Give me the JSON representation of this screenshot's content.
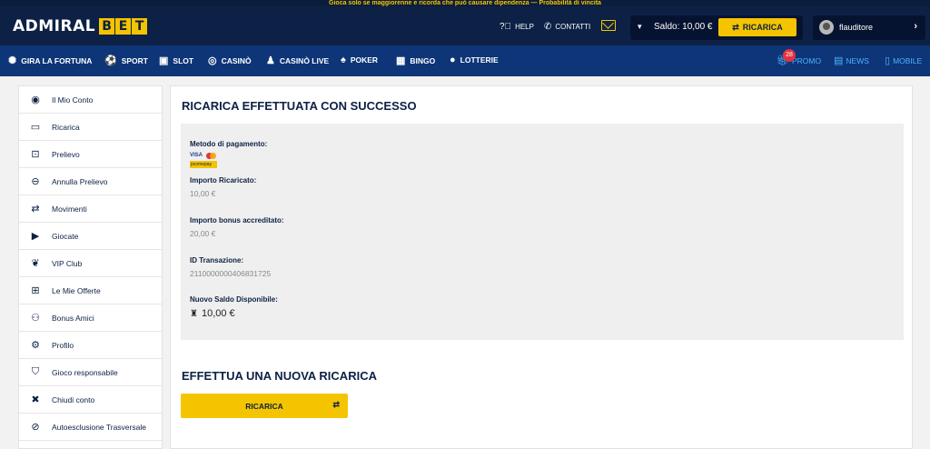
{
  "topbar": {
    "notice": "Gioca solo se maggiorenne e ricorda che può causare dipendenza — Probabilità di vincita"
  },
  "header": {
    "logo_left": "ADMIRAL",
    "logo_right": [
      "B",
      "E",
      "T"
    ],
    "help_label": "HELP",
    "contacts_label": "CONTATTI",
    "saldo_text": "Saldo: 10,00 €",
    "ricarica_label": "RICARICA",
    "username": "flauditore"
  },
  "nav": {
    "items": [
      {
        "label": "GIRA LA FORTUNA",
        "icon": "wheel-icon"
      },
      {
        "label": "SPORT",
        "icon": "soccer-ball-icon"
      },
      {
        "label": "SLOT",
        "icon": "slot-machine-icon"
      },
      {
        "label": "CASINÒ",
        "icon": "roulette-icon"
      },
      {
        "label": "CASINÒ LIVE",
        "icon": "live-dealer-icon"
      },
      {
        "label": "POKER",
        "icon": "cards-icon"
      },
      {
        "label": "BINGO",
        "icon": "bingo-icon"
      },
      {
        "label": "LOTTERIE",
        "icon": "lottery-ball-icon"
      }
    ],
    "right": [
      {
        "label": "PROMO",
        "icon": "gift-icon"
      },
      {
        "label": "NEWS",
        "icon": "calendar-icon"
      },
      {
        "label": "MOBILE",
        "icon": "phone-icon"
      }
    ],
    "promo_badge": "28"
  },
  "sidebar": {
    "items": [
      {
        "label": "Il Mio Conto",
        "icon": "user-circle-icon"
      },
      {
        "label": "Ricarica",
        "icon": "credit-card-icon"
      },
      {
        "label": "Prelievo",
        "icon": "cash-icon"
      },
      {
        "label": "Annulla Prelievo",
        "icon": "minus-circle-icon"
      },
      {
        "label": "Movimenti",
        "icon": "transfer-arrows-icon"
      },
      {
        "label": "Giocate",
        "icon": "play-icon"
      },
      {
        "label": "VIP Club",
        "icon": "laurel-icon"
      },
      {
        "label": "Le Mie Offerte",
        "icon": "gift-icon"
      },
      {
        "label": "Bonus Amici",
        "icon": "friends-icon"
      },
      {
        "label": "Profilo",
        "icon": "gear-icon"
      },
      {
        "label": "Gioco responsabile",
        "icon": "shield-icon"
      },
      {
        "label": "Chiudi conto",
        "icon": "close-icon"
      },
      {
        "label": "Autoesclusione Trasversale",
        "icon": "ban-icon"
      }
    ]
  },
  "main": {
    "title": "RICARICA EFFETTUATA CON SUCCESSO",
    "payment_method_label": "Metodo di pagamento:",
    "payment_logos": {
      "visa": "VISA",
      "paypal": "pcomepay"
    },
    "amount_label": "Importo Ricaricato:",
    "amount_value": "10,00 €",
    "bonus_label": "Importo bonus accreditato:",
    "bonus_value": "20,00 €",
    "transaction_label": "ID Transazione:",
    "transaction_value": "2110000000406831725",
    "new_balance_label": "Nuovo Saldo Disponibile:",
    "new_balance_value": "10,00 €",
    "new_recharge_title": "EFFETTUA UNA NUOVA RICARICA",
    "recharge_button_label": "RICARICA"
  }
}
